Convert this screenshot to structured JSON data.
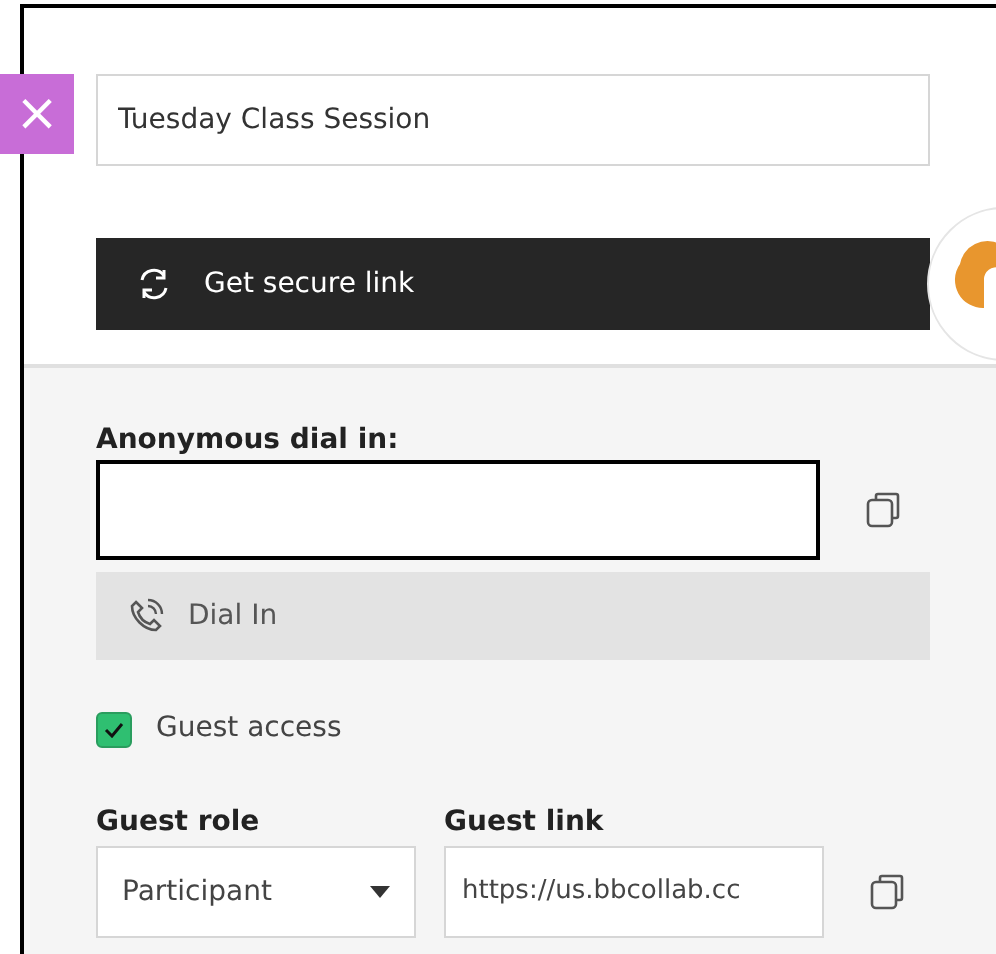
{
  "close_button": {
    "label": "×"
  },
  "session_name": {
    "value": "Tuesday Class Session"
  },
  "secure_link_button": {
    "label": "Get secure link"
  },
  "anonymous_dial_in": {
    "label": "Anonymous dial in:"
  },
  "dial_in_button": {
    "label": "Dial In"
  },
  "guest_access": {
    "label": "Guest access",
    "checked": true
  },
  "guest_role": {
    "label": "Guest role",
    "value": "Participant"
  },
  "guest_link": {
    "label": "Guest link",
    "value": "https://us.bbcollab.cc"
  }
}
